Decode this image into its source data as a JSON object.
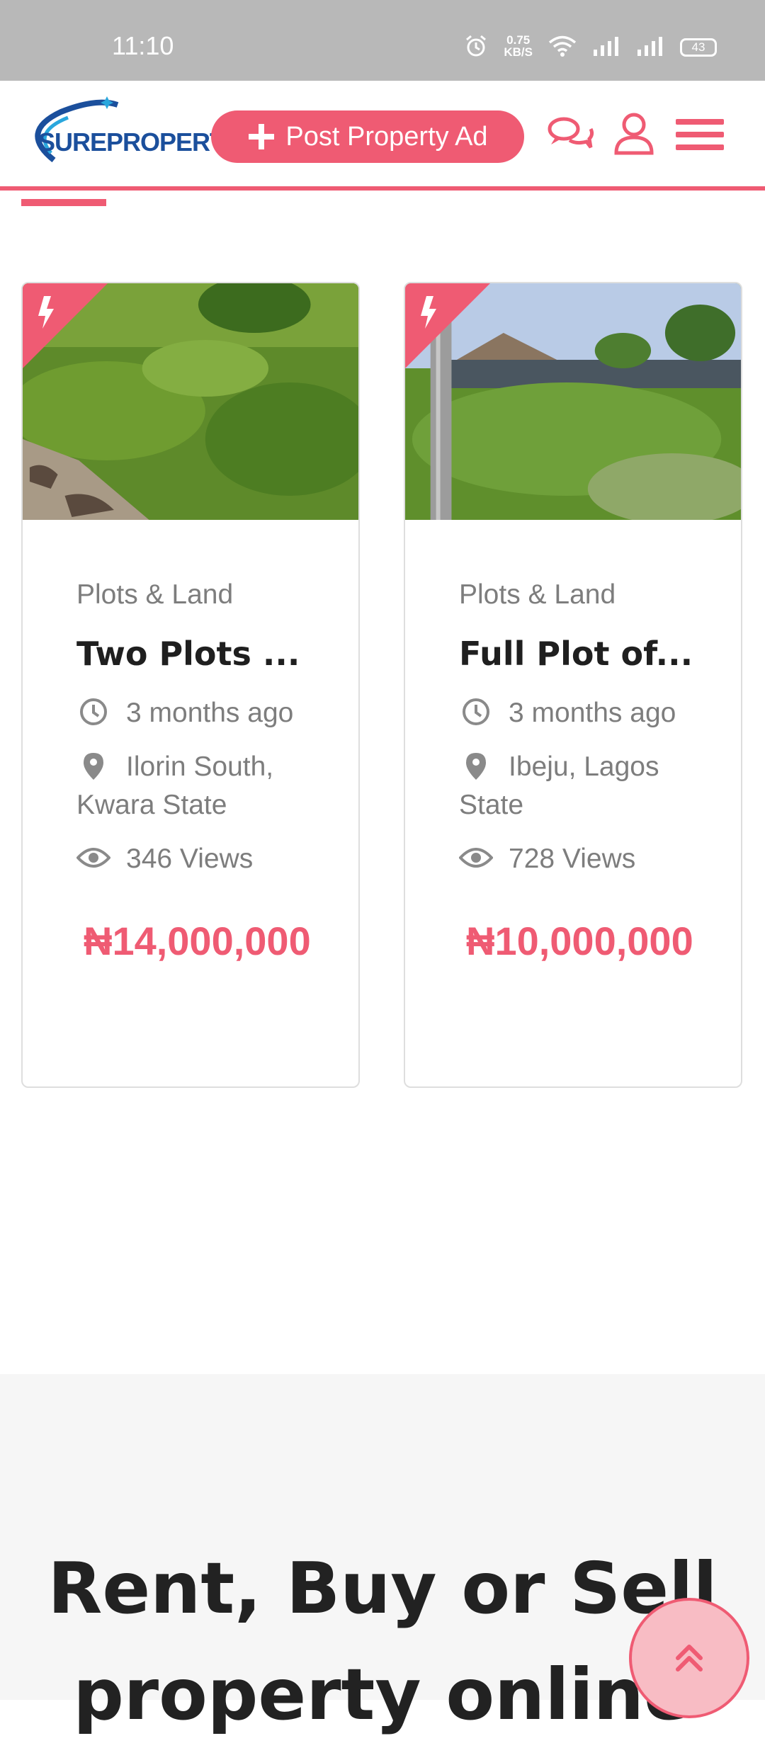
{
  "status_bar": {
    "time": "11:10",
    "net_speed_value": "0.75",
    "net_speed_unit": "KB/S",
    "battery": "43"
  },
  "header": {
    "logo_text": "SUREPROPERT",
    "post_button_label": "Post Property Ad",
    "accent_color": "#ef5b73",
    "icons": [
      "chat-icon",
      "user-icon",
      "menu-icon"
    ]
  },
  "listings": [
    {
      "category": "Plots & Land",
      "title": "Two Plots ...",
      "posted": "3 months ago",
      "location": "Ilorin South, Kwara State",
      "views": "346 Views",
      "price": "₦14,000,000"
    },
    {
      "category": "Plots & Land",
      "title": "Full Plot of...",
      "posted": "3 months ago",
      "location": "Ibeju, Lagos State",
      "views": "728 Views",
      "price": "₦10,000,000"
    }
  ],
  "hero": {
    "heading_line1": "Rent, Buy or Sell",
    "heading_line2": "property online"
  }
}
